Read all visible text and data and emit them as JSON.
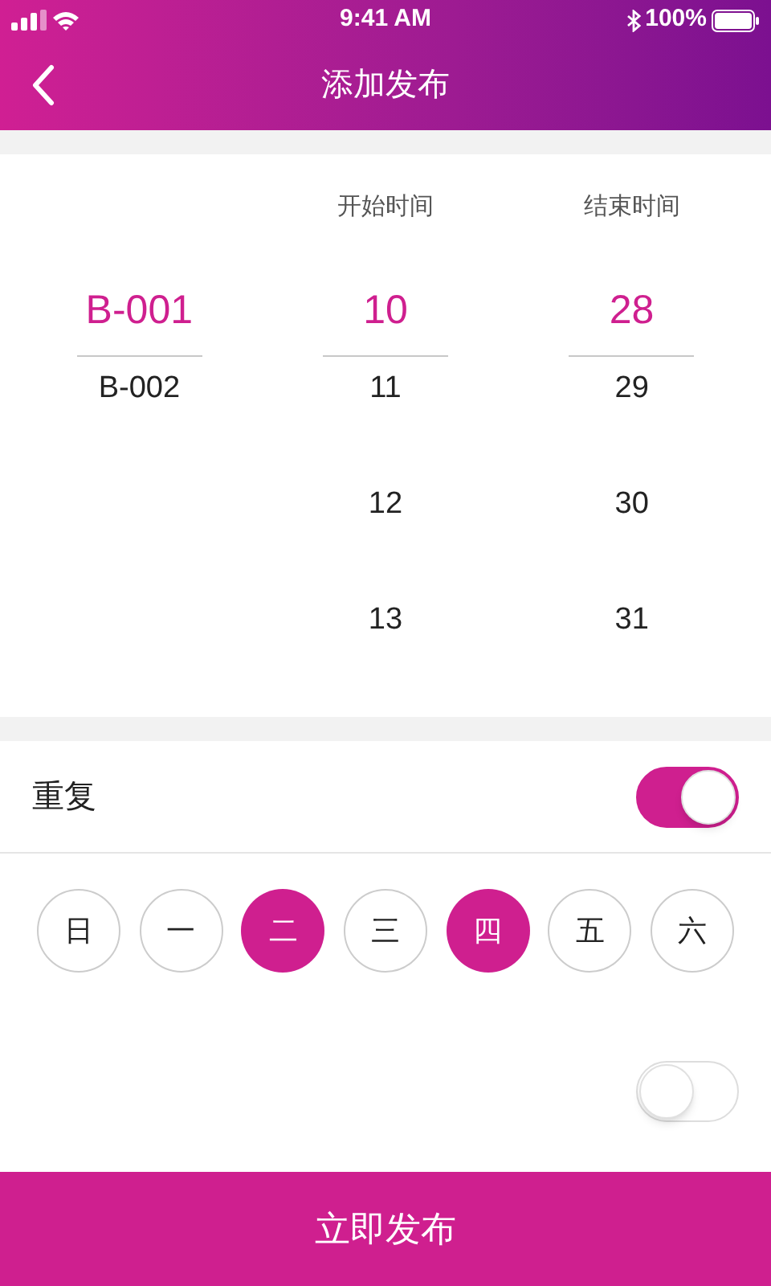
{
  "status_bar": {
    "time": "9:41 AM",
    "battery": "100%"
  },
  "nav": {
    "title": "添加发布"
  },
  "picker": {
    "columns": [
      {
        "items": [
          {
            "label": "B-001",
            "selected": true
          },
          {
            "label": "B-002",
            "selected": false
          }
        ]
      },
      {
        "header": "开始时间",
        "items": [
          {
            "label": "10",
            "selected": true
          },
          {
            "label": "11",
            "selected": false
          },
          {
            "label": "12",
            "selected": false
          },
          {
            "label": "13",
            "selected": false
          }
        ]
      },
      {
        "header": "结束时间",
        "items": [
          {
            "label": "28",
            "selected": true
          },
          {
            "label": "29",
            "selected": false
          },
          {
            "label": "30",
            "selected": false
          },
          {
            "label": "31",
            "selected": false
          }
        ]
      }
    ]
  },
  "repeat": {
    "label": "重复",
    "on": true
  },
  "days": [
    {
      "label": "日",
      "selected": false
    },
    {
      "label": "一",
      "selected": false
    },
    {
      "label": "二",
      "selected": true
    },
    {
      "label": "三",
      "selected": false
    },
    {
      "label": "四",
      "selected": true
    },
    {
      "label": "五",
      "selected": false
    },
    {
      "label": "六",
      "selected": false
    }
  ],
  "second_toggle": {
    "on": false
  },
  "publish_button": {
    "label": "立即发布"
  }
}
